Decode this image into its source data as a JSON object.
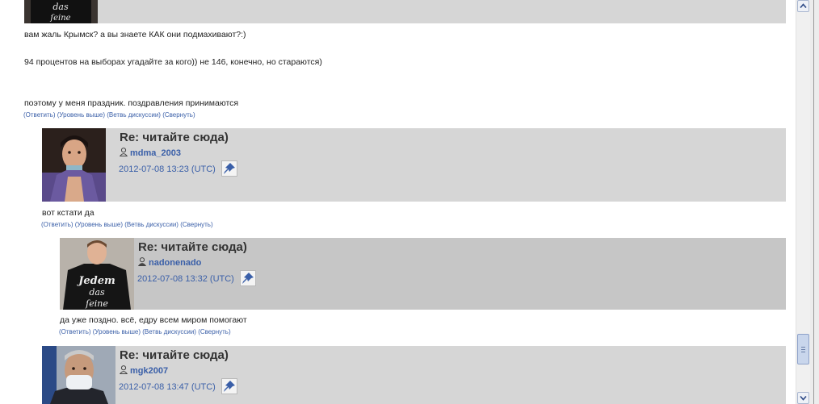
{
  "colors": {
    "band": "#d6d6d6",
    "band_dark": "#c6c6c6",
    "link": "#3a5fa8"
  },
  "actions": [
    "(Ответить)",
    "(Уровень выше)",
    "(Ветвь дискуссии)",
    "(Свернуть)"
  ],
  "top_comment": {
    "lines": [
      "вам жаль Крымск? а вы знаете КАК они подмахивают?:)",
      "94 процентов на выборах угадайте за кого)) не 146, конечно, но стараются)",
      "поэтому у меня праздник. поздравления принимаются"
    ]
  },
  "comments": [
    {
      "subject": "Re: читайте сюда)",
      "user": "mdma_2003",
      "user_icon": "user-icon",
      "date": "2012-07-08 13:23 (UTC)",
      "text": "вот кстати да"
    },
    {
      "subject": "Re: читайте сюда)",
      "user": "nadonenado",
      "user_icon": "user-icon",
      "date": "2012-07-08 13:32 (UTC)",
      "text": "да уже поздно. всё, едру всем миром помогают"
    },
    {
      "subject": "Re: читайте сюда)",
      "user": "mgk2007",
      "user_icon": "user-icon",
      "date": "2012-07-08 13:47 (UTC)"
    }
  ],
  "avatar_texts": {
    "shirt_top": "das\nʃeine",
    "shirt_full": "Jedem\ndas\nʃeine"
  },
  "scrollbar": {
    "up_icon": "arrow-up-icon",
    "down_icon": "arrow-down-icon"
  }
}
